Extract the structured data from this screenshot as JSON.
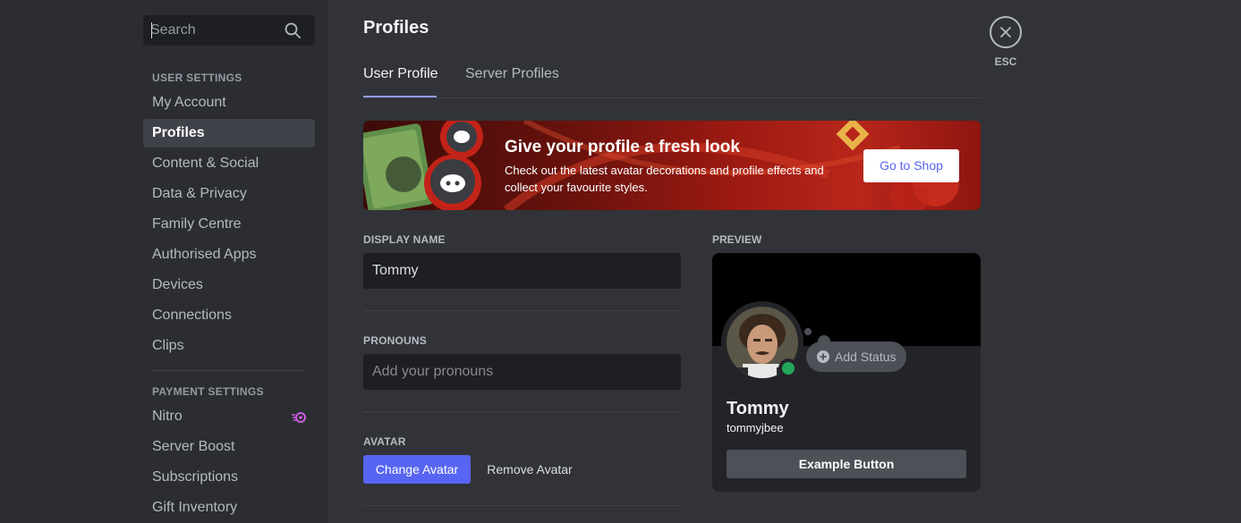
{
  "search": {
    "placeholder": "Search"
  },
  "sidebar": {
    "user_settings_header": "USER SETTINGS",
    "user_items": [
      {
        "label": "My Account"
      },
      {
        "label": "Profiles",
        "selected": true
      },
      {
        "label": "Content & Social"
      },
      {
        "label": "Data & Privacy"
      },
      {
        "label": "Family Centre"
      },
      {
        "label": "Authorised Apps"
      },
      {
        "label": "Devices"
      },
      {
        "label": "Connections"
      },
      {
        "label": "Clips"
      }
    ],
    "payment_settings_header": "PAYMENT SETTINGS",
    "payment_items": [
      {
        "label": "Nitro",
        "icon": "nitro-icon"
      },
      {
        "label": "Server Boost"
      },
      {
        "label": "Subscriptions"
      },
      {
        "label": "Gift Inventory"
      }
    ]
  },
  "main": {
    "title": "Profiles",
    "tabs": [
      {
        "label": "User Profile",
        "active": true
      },
      {
        "label": "Server Profiles"
      }
    ],
    "close_label": "ESC"
  },
  "banner": {
    "title": "Give your profile a fresh look",
    "description": "Check out the latest avatar decorations and profile effects and collect your favourite styles.",
    "button": "Go to Shop"
  },
  "form": {
    "display_name_label": "DISPLAY NAME",
    "display_name_value": "Tommy",
    "pronouns_label": "PRONOUNS",
    "pronouns_placeholder": "Add your pronouns",
    "avatar_label": "AVATAR",
    "change_avatar": "Change Avatar",
    "remove_avatar": "Remove Avatar"
  },
  "preview": {
    "label": "PREVIEW",
    "add_status": "Add Status",
    "name": "Tommy",
    "username": "tommyjbee",
    "example_button": "Example Button",
    "status": "online"
  },
  "colors": {
    "accent": "#5865f2",
    "online": "#23a55a",
    "selected_bg": "#404249",
    "tab_underline": "#949cf7"
  }
}
